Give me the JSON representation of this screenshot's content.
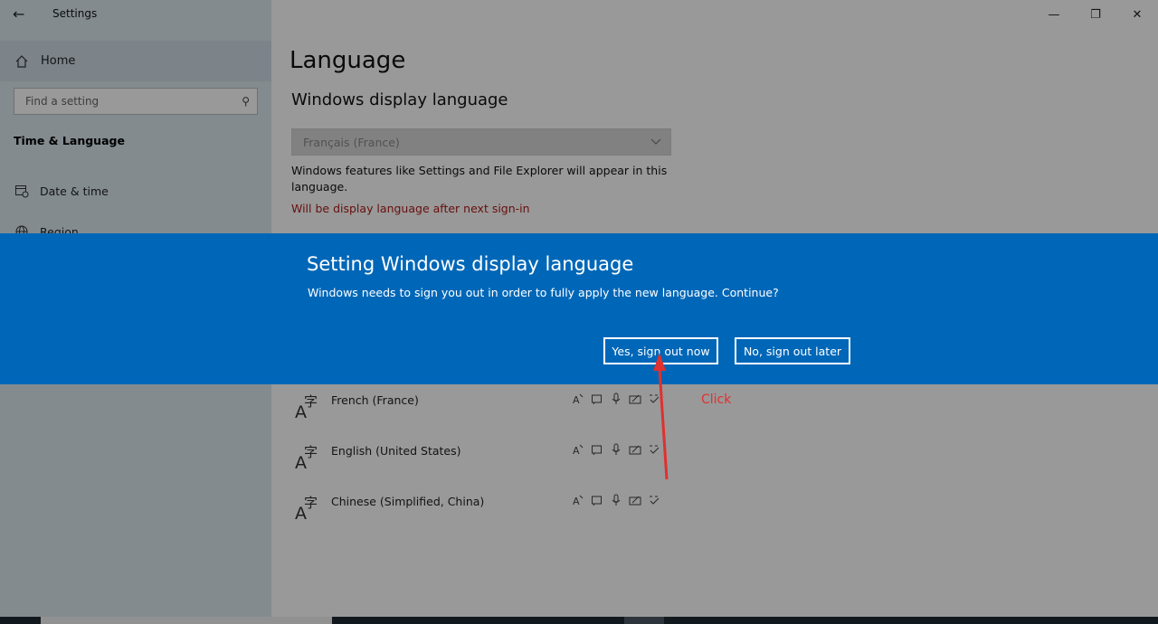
{
  "window": {
    "title": "Settings",
    "controls": {
      "minimize": "—",
      "maximize": "❐",
      "close": "✕"
    }
  },
  "sidebar": {
    "home_label": "Home",
    "search_placeholder": "Find a setting",
    "section_title": "Time & Language",
    "items": [
      {
        "label": "Date & time",
        "icon": "calendar-clock-icon"
      },
      {
        "label": "Region",
        "icon": "globe-icon"
      }
    ]
  },
  "main": {
    "page_title": "Language",
    "subtitle": "Windows display language",
    "dropdown_value": "Français (France)",
    "description": "Windows features like Settings and File Explorer will appear in this language.",
    "warning": "Will be display language after next sign-in",
    "languages": [
      {
        "name": "French (France)"
      },
      {
        "name": "English (United States)"
      },
      {
        "name": "Chinese (Simplified, China)"
      }
    ]
  },
  "dialog": {
    "title": "Setting Windows display language",
    "message": "Windows needs to sign you out in order to fully apply the new language. Continue?",
    "yes_label": "Yes, sign out now",
    "no_label": "No, sign out later"
  },
  "annotation": {
    "text": "Click",
    "color": "#e03030"
  },
  "colors": {
    "dialog_bg": "#0067b8",
    "warning": "#b01a1a",
    "sidebar_bg": "#dbe8ef"
  }
}
